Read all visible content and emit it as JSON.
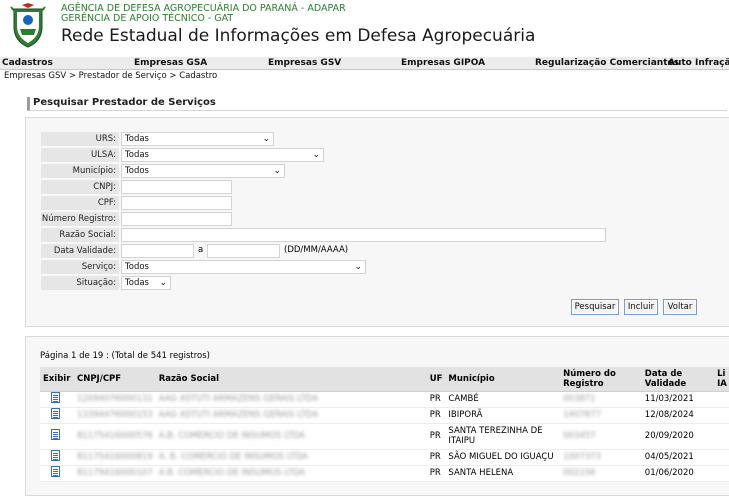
{
  "header": {
    "agency_line1": "AGÊNCIA DE DEFESA AGROPECUÁRIA DO PARANÁ - ADAPAR",
    "agency_line2": "GERÊNCIA DE APOIO TÉCNICO - GAT",
    "system_title": "Rede Estadual de Informações em Defesa Agropecuária",
    "logo_icon": "parana-coat-of-arms-icon"
  },
  "menu": {
    "items": [
      "Cadastros",
      "Empresas GSA",
      "Empresas GSV",
      "Empresas GIPOA",
      "Regularização Comerciantes",
      "Auto Infração"
    ]
  },
  "breadcrumb": "Empresas GSV > Prestador de Serviço > Cadastro",
  "search": {
    "title": "Pesquisar Prestador de Serviços",
    "fields": {
      "urs": {
        "label": "URS:",
        "value": "Todas"
      },
      "ulsa": {
        "label": "ULSA:",
        "value": "Todas"
      },
      "municipio": {
        "label": "Município:",
        "value": "Todos"
      },
      "cnpj": {
        "label": "CNPJ:",
        "value": ""
      },
      "cpf": {
        "label": "CPF:",
        "value": ""
      },
      "numero_registro": {
        "label": "Número Registro:",
        "value": ""
      },
      "razao_social": {
        "label": "Razão Social:",
        "value": ""
      },
      "data_validade": {
        "label": "Data Validade:",
        "from": "",
        "separator": "a",
        "to": "",
        "hint": "(DD/MM/AAAA)"
      },
      "servico": {
        "label": "Serviço:",
        "value": "Todos"
      },
      "situacao": {
        "label": "Situação:",
        "value": "Todas"
      }
    },
    "buttons": {
      "pesquisar": "Pesquisar",
      "incluir": "Incluir",
      "voltar": "Voltar"
    }
  },
  "results": {
    "pager": "Página 1 de 19 : (Total de 541 registros)",
    "columns": {
      "exibir": "Exibir",
      "cnpj": "CNPJ/CPF",
      "razao": "Razão Social",
      "uf": "UF",
      "municipio": "Município",
      "numero": "Número do Registro",
      "validade": "Data de Validade",
      "extra": "Li IA"
    },
    "rows": [
      {
        "cnpj": "12094076000131",
        "razao": "AAG ASTUTI ARMAZENS GERAIS LTDA",
        "uf": "PR",
        "municipio": "CAMBÉ",
        "numero": "003871",
        "validade": "11/03/2021"
      },
      {
        "cnpj": "13394476000153",
        "razao": "AAG ASTUTI ARMAZENS GERAIS LTDA",
        "uf": "PR",
        "municipio": "IBIPORÃ",
        "numero": "1407877",
        "validade": "12/08/2024"
      },
      {
        "cnpj": "81175416000576",
        "razao": "A.B. COMERCIO DE INSUMOS LTDA",
        "uf": "PR",
        "municipio": "SANTA TEREZINHA DE ITAIPU",
        "numero": "003457",
        "validade": "20/09/2020"
      },
      {
        "cnpj": "81175416000819",
        "razao": "A. B. COMERCIO DE INSUMOS LTDA",
        "uf": "PR",
        "municipio": "SÃO MIGUEL DO IGUAÇU",
        "numero": "1007373",
        "validade": "04/05/2021"
      },
      {
        "cnpj": "81179416000107",
        "razao": "A.B. COMERCIO DE INSUMOS LTDA",
        "uf": "PR",
        "municipio": "SANTA HELENA",
        "numero": "002156",
        "validade": "01/06/2020"
      }
    ]
  },
  "colors": {
    "green_text": "#2e7d32",
    "button_border": "#7a9cc9",
    "label_bg": "#e6e6e6"
  }
}
